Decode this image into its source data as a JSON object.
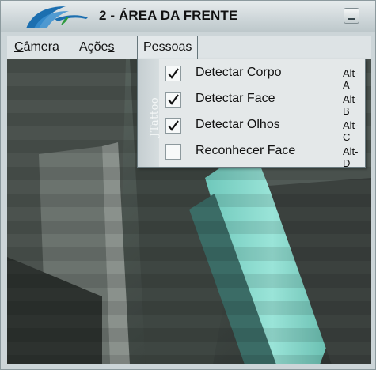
{
  "window": {
    "title": "2 - ÁREA DA FRENTE"
  },
  "menubar": {
    "items": [
      {
        "label_underlined": "C",
        "label_rest": "âmera"
      },
      {
        "label_pre": "Açõe",
        "label_underlined": "s"
      },
      {
        "label": "Pessoas"
      }
    ]
  },
  "dropdown": {
    "side_text": "JTattoo",
    "items": [
      {
        "label": "Detectar Corpo",
        "accelerator": "Alt-A",
        "checked": true
      },
      {
        "label": "Detectar Face",
        "accelerator": "Alt-B",
        "checked": true
      },
      {
        "label": "Detectar Olhos",
        "accelerator": "Alt-C",
        "checked": true
      },
      {
        "label": "Reconhecer Face",
        "accelerator": "Alt-D",
        "checked": false
      }
    ]
  },
  "colors": {
    "video_teal": "#7fd6c9",
    "titlebar": "#cfd7da",
    "menu_border": "#66767b"
  }
}
